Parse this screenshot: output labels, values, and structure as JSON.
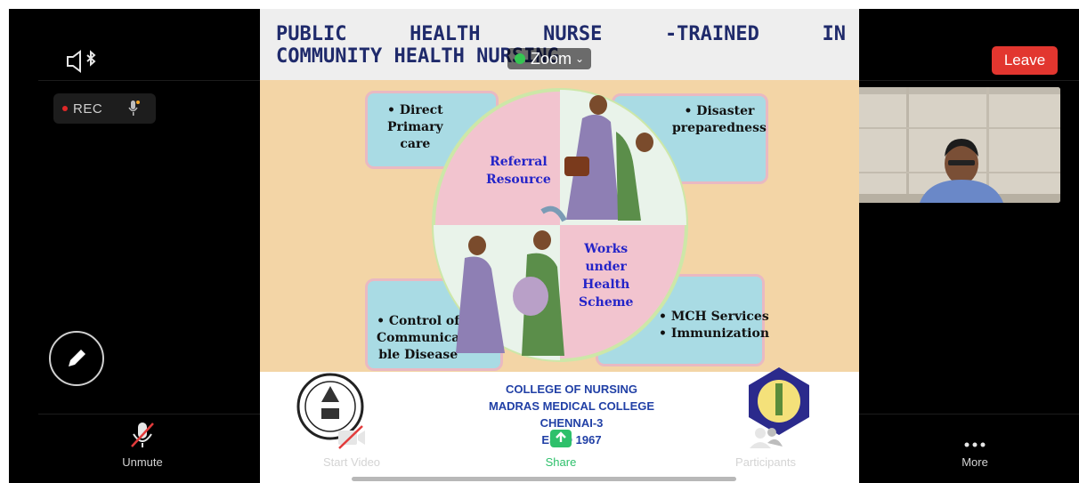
{
  "topbar": {
    "speaker_icon": "speaker-bluetooth-icon",
    "rec_label": "REC",
    "leave_label": "Leave",
    "zoom_label": "Zoom"
  },
  "slide": {
    "title_words_line1": [
      "PUBLIC",
      "HEALTH",
      "NURSE",
      "-TRAINED",
      "IN"
    ],
    "title_line2": "COMMUNITY HEALTH NURSING",
    "cards": [
      {
        "text": "• Direct\nPrimary\ncare"
      },
      {
        "text": "• Disaster\npreparedness"
      },
      {
        "text": "• Control of\nCommunica\nble Disease"
      },
      {
        "text": "• MCH Services\n• Immunization"
      }
    ],
    "quadrants": [
      {
        "text": "Referral\nResource"
      },
      {
        "text": "Works\nunder\nHealth\nScheme"
      }
    ],
    "college": {
      "line1": "COLLEGE OF NURSING",
      "line2": "MADRAS MEDICAL COLLEGE",
      "line3": "CHENNAI-3",
      "line4": "ESTD 1967"
    }
  },
  "toolbar": {
    "items": [
      {
        "label": "Unmute",
        "icon": "microphone-muted-icon"
      },
      {
        "label": "Start Video",
        "icon": "video-camera-off-icon"
      },
      {
        "label": "Share",
        "icon": "share-screen-icon"
      },
      {
        "label": "Participants",
        "icon": "participants-icon"
      },
      {
        "label": "More",
        "icon": "more-dots-icon"
      }
    ]
  },
  "colors": {
    "leave": "#e2362f",
    "share": "#2ec06b",
    "rec_dot": "#e02828"
  }
}
